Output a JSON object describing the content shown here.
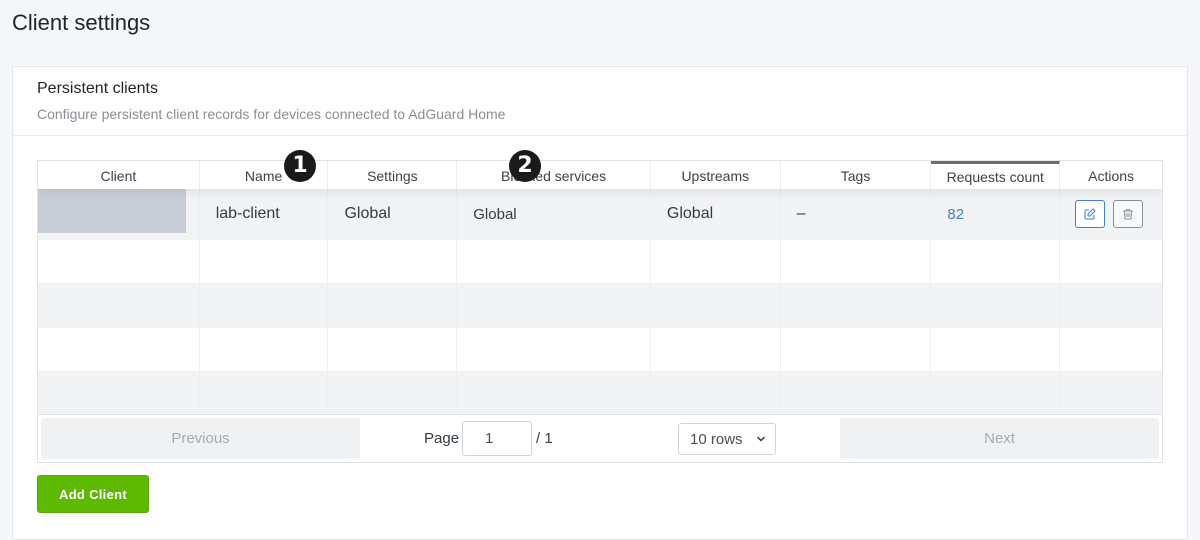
{
  "page": {
    "title": "Client settings"
  },
  "card": {
    "title": "Persistent clients",
    "subtitle": "Configure persistent client records for devices connected to AdGuard Home"
  },
  "table": {
    "columns": [
      "Client",
      "Name",
      "Settings",
      "Blocked services",
      "Upstreams",
      "Tags",
      "Requests count",
      "Actions"
    ],
    "rows": [
      {
        "client": "",
        "name": "lab-client",
        "settings": "Global",
        "blocked_services": "Global",
        "upstreams": "Global",
        "tags": "–",
        "requests": "82"
      }
    ]
  },
  "pagination": {
    "previous": "Previous",
    "next": "Next",
    "page_label": "Page",
    "page_value": "1",
    "total": "/ 1",
    "rows_option": "10 rows"
  },
  "add_button": "Add Client",
  "badges": [
    "1",
    "2"
  ],
  "colors": {
    "accent": "#467fcf",
    "success": "#5eba00"
  }
}
